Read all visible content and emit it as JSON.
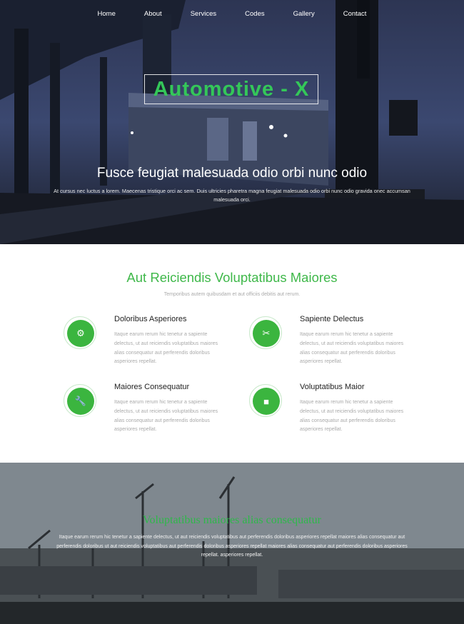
{
  "nav": {
    "items": [
      {
        "label": "Home"
      },
      {
        "label": "About"
      },
      {
        "label": "Services"
      },
      {
        "label": "Codes"
      },
      {
        "label": "Gallery"
      },
      {
        "label": "Contact"
      }
    ]
  },
  "hero": {
    "logo": "Automotive - X",
    "title": "Fusce feugiat malesuada odio orbi nunc odio",
    "subtitle": "At cursus nec luctus a lorem. Maecenas tristique orci ac sem. Duis ultricies pharetra magna feugiat malesuada odio orbi nunc odio gravida onec accumsan malesuada orci."
  },
  "features": {
    "title": "Aut Reiciendis Voluptatibus Maiores",
    "subtitle": "Temporibus autem quibusdam et aut officiis debitis aut rerum.",
    "items": [
      {
        "title": "Doloribus Asperiores",
        "text": "Itaque earum rerum hic tenetur a sapiente delectus, ut aut reiciendis voluptatibus maiores alias consequatur aut perferendis doloribus asperiores repellat.",
        "icon": "gear-icon",
        "glyph": "⚙"
      },
      {
        "title": "Sapiente Delectus",
        "text": "Itaque earum rerum hic tenetur a sapiente delectus, ut aut reiciendis voluptatibus maiores alias consequatur aut perferendis doloribus asperiores repellat.",
        "icon": "scissors-icon",
        "glyph": "✂"
      },
      {
        "title": "Maiores Consequatur",
        "text": "Itaque earum rerum hic tenetur a sapiente delectus, ut aut reiciendis voluptatibus maiores alias consequatur aut perferendis doloribus asperiores repellat.",
        "icon": "wrench-icon",
        "glyph": "🔧"
      },
      {
        "title": "Voluptatibus Maior",
        "text": "Itaque earum rerum hic tenetur a sapiente delectus, ut aut reiciendis voluptatibus maiores alias consequatur aut perferendis doloribus asperiores repellat.",
        "icon": "square-icon",
        "glyph": "■"
      }
    ]
  },
  "bottom": {
    "title": "Voluptatibus maiores alias consequatur",
    "text": "Itaque earum rerum hic tenetur a sapiente delectus, ut aut reiciendis voluptatibus aut perferendis doloribus asperiores repellat maiores alias consequatur aut perferendis doloribus ut aut reiciendis voluptatibus aut perferendis doloribus asperiores repellat maiores alias consequatur aut perferendis doloribus asperiores repellat. asperiores repellat."
  },
  "colors": {
    "accent": "#3bb53f",
    "hero_dark": "#1d2233"
  }
}
